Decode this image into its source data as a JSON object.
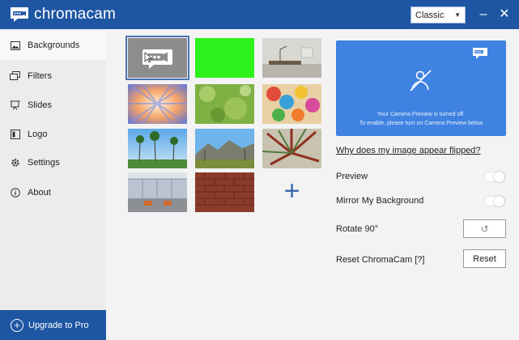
{
  "app": {
    "name": "chromacam",
    "mode_select": {
      "value": "Classic"
    },
    "window_controls": {
      "minimize": "–",
      "close": "✕"
    }
  },
  "sidebar": {
    "items": [
      {
        "label": "Backgrounds",
        "icon": "image-icon",
        "active": true
      },
      {
        "label": "Filters",
        "icon": "layers-icon",
        "active": false
      },
      {
        "label": "Slides",
        "icon": "slides-icon",
        "active": false
      },
      {
        "label": "Logo",
        "icon": "logo-square-icon",
        "active": false
      },
      {
        "label": "Settings",
        "icon": "gear-icon",
        "active": false
      },
      {
        "label": "About",
        "icon": "info-icon",
        "active": false
      }
    ],
    "upgrade": {
      "label": "Upgrade to Pro",
      "icon": "plus-circle-icon"
    }
  },
  "backgrounds": {
    "tiles": [
      {
        "name": "chromacam logo",
        "selected": true
      },
      {
        "name": "green screen"
      },
      {
        "name": "living room"
      },
      {
        "name": "sunburst rays"
      },
      {
        "name": "green bokeh"
      },
      {
        "name": "colorful balloons"
      },
      {
        "name": "palm trees"
      },
      {
        "name": "desert mountains"
      },
      {
        "name": "palm leaves"
      },
      {
        "name": "modern office"
      },
      {
        "name": "brick wall"
      }
    ],
    "add_label": "+"
  },
  "preview": {
    "line1": "Your Camera Preview is turned off.",
    "line2": "To enable, please turn on Camera Preview below"
  },
  "settings": {
    "help_link": "Why does my image appear flipped?",
    "preview_label": "Preview",
    "preview_on": false,
    "mirror_label": "Mirror My Background",
    "mirror_on": false,
    "rotate_label": "Rotate 90°",
    "rotate_button": "↺",
    "reset_label": "Reset ChromaCam [?]",
    "reset_button": "Reset"
  },
  "colors": {
    "brand": "#1f56a3",
    "preview_bg": "#3f82e1",
    "green_screen": "#2ef21c"
  }
}
